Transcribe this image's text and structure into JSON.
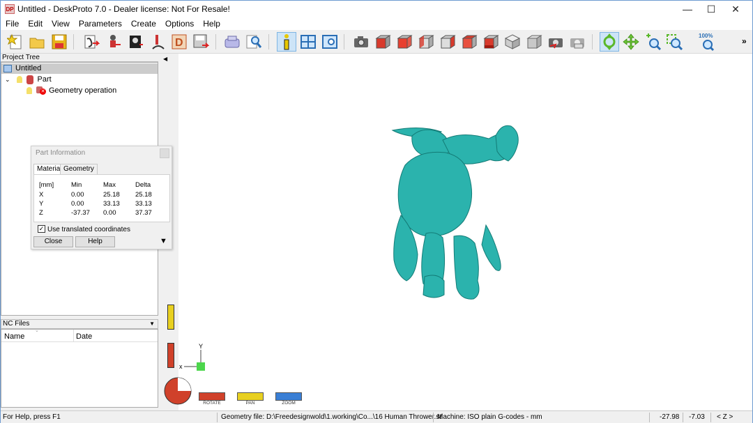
{
  "window": {
    "title": "Untitled - DeskProto 7.0 - Dealer license: Not For Resale!",
    "icon_label": "DP",
    "minimize_glyph": "—",
    "maximize_glyph": "☐",
    "close_glyph": "✕"
  },
  "menu": [
    "File",
    "Edit",
    "View",
    "Parameters",
    "Create",
    "Options",
    "Help"
  ],
  "toolbar": {
    "icons": [
      "new-file-icon",
      "open-folder-icon",
      "save-icon",
      "import-geometry-icon",
      "import-vector-icon",
      "import-bitmap-icon",
      "vector-toolpath-icon",
      "d-icon",
      "export-icon",
      "machine-icon",
      "search-icon",
      "info-icon",
      "layout-icon",
      "preview-icon",
      "camera-icon",
      "view-front-icon",
      "view-back-icon",
      "view-left-icon",
      "view-right-icon",
      "view-top-icon",
      "view-bottom-icon",
      "view-iso-icon",
      "view-iso2-icon",
      "camera-reset-icon",
      "camera-print-icon",
      "rotate-icon",
      "pan-icon",
      "zoom-in-icon",
      "zoom-window-icon",
      "zoom-100-icon"
    ],
    "zoom_label": "100%",
    "overflow": "»"
  },
  "project_tree": {
    "header": "Project Tree",
    "root": "Untitled",
    "part": "Part",
    "operation": "Geometry operation"
  },
  "nc_files": {
    "header": "NC Files",
    "columns": [
      "Name",
      "Date"
    ]
  },
  "part_info": {
    "title": "Part Information",
    "tabs": [
      "Material",
      "Geometry"
    ],
    "headers": [
      "[mm]",
      "Min",
      "Max",
      "Delta"
    ],
    "rows": [
      [
        "X",
        "0.00",
        "25.18",
        "25.18"
      ],
      [
        "Y",
        "0.00",
        "33.13",
        "33.13"
      ],
      [
        "Z",
        "-37.37",
        "0.00",
        "37.37"
      ]
    ],
    "checkbox_label": "Use translated coordinates",
    "checkbox_checked": true,
    "close_label": "Close",
    "help_label": "Help"
  },
  "viewport": {
    "model_color": "#2bb3ad",
    "axis_y": "Y",
    "axis_x": "x",
    "rotate_label": "ROTATE",
    "pan_label": "PAN",
    "zoom_label": "ZOOM"
  },
  "status": {
    "help": "For Help, press F1",
    "geometry_file": "Geometry file: D:\\Freedesignwold\\1.working\\Co...\\16 Human Thrower.stl",
    "machine": "Machine: ISO plain G-codes - mm",
    "coord1": "-27.98",
    "coord2": "-7.03",
    "axis": "< Z >"
  }
}
